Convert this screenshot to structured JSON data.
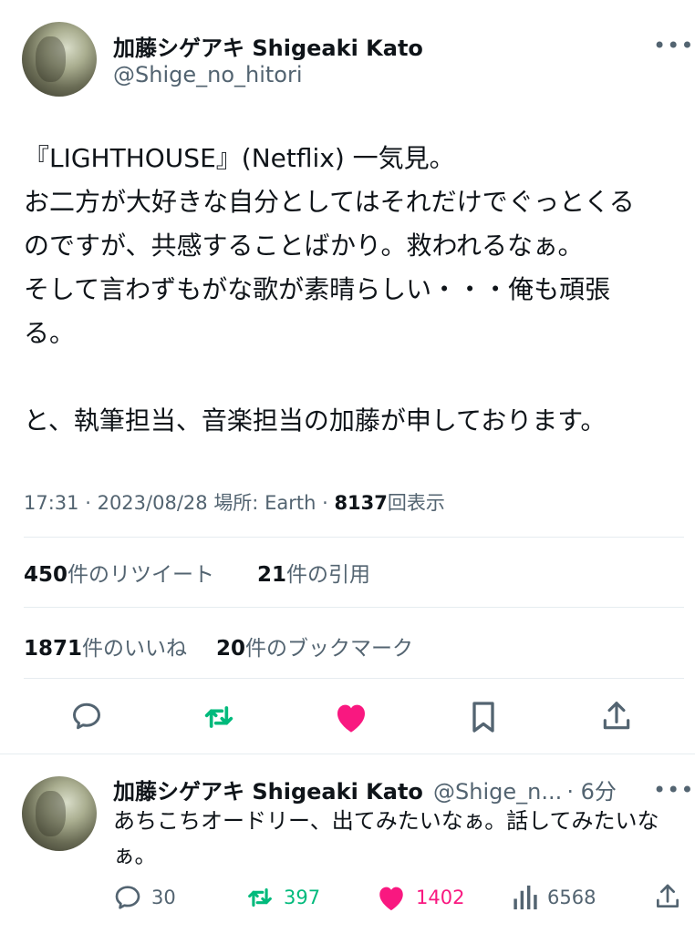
{
  "main_tweet": {
    "author_name": "加藤シゲアキ Shigeaki Kato",
    "author_handle": "@Shige_no_hitori",
    "more_label": "•••",
    "text": "『LIGHTHOUSE』(Netflix) 一気見。\nお二方が大好きな自分としてはそれだけでぐっとくる\nのですが、共感することばかり。救われるなぁ。\nそして言わずもがな歌が素晴らしい・・・俺も頑張\nる。\n\nと、執筆担当、音楽担当の加藤が申しております。",
    "time": "17:31",
    "date": "2023/08/28",
    "location_label": "場所: Earth",
    "views_count": "8137",
    "views_label": "回表示",
    "stats": {
      "retweets_count": "450",
      "retweets_label": "件のリツイート",
      "quotes_count": "21",
      "quotes_label": "件の引用",
      "likes_count": "1871",
      "likes_label": "件のいいね",
      "bookmarks_count": "20",
      "bookmarks_label": "件のブックマーク"
    }
  },
  "reply_tweet": {
    "author_name": "加藤シゲアキ Shigeaki Kato",
    "author_handle": "@Shige_n...",
    "time_ago": "· 6分",
    "more_label": "•••",
    "text": "あちこちオードリー、出てみたいなぁ。話してみたいなぁ。",
    "reply_count": "30",
    "retweet_count": "397",
    "like_count": "1402",
    "view_count": "6568"
  },
  "colors": {
    "text_primary": "#0f1419",
    "text_secondary": "#536471",
    "retweet_green": "#00ba7c",
    "like_pink": "#f91880",
    "divider": "#e6ecf0"
  },
  "icons": {
    "reply": "speech-bubble-icon",
    "retweet": "retweet-arrows-icon",
    "like": "heart-filled-icon",
    "bookmark": "bookmark-icon",
    "share": "share-upload-icon",
    "views": "bar-chart-icon",
    "more": "more-dots-icon"
  }
}
